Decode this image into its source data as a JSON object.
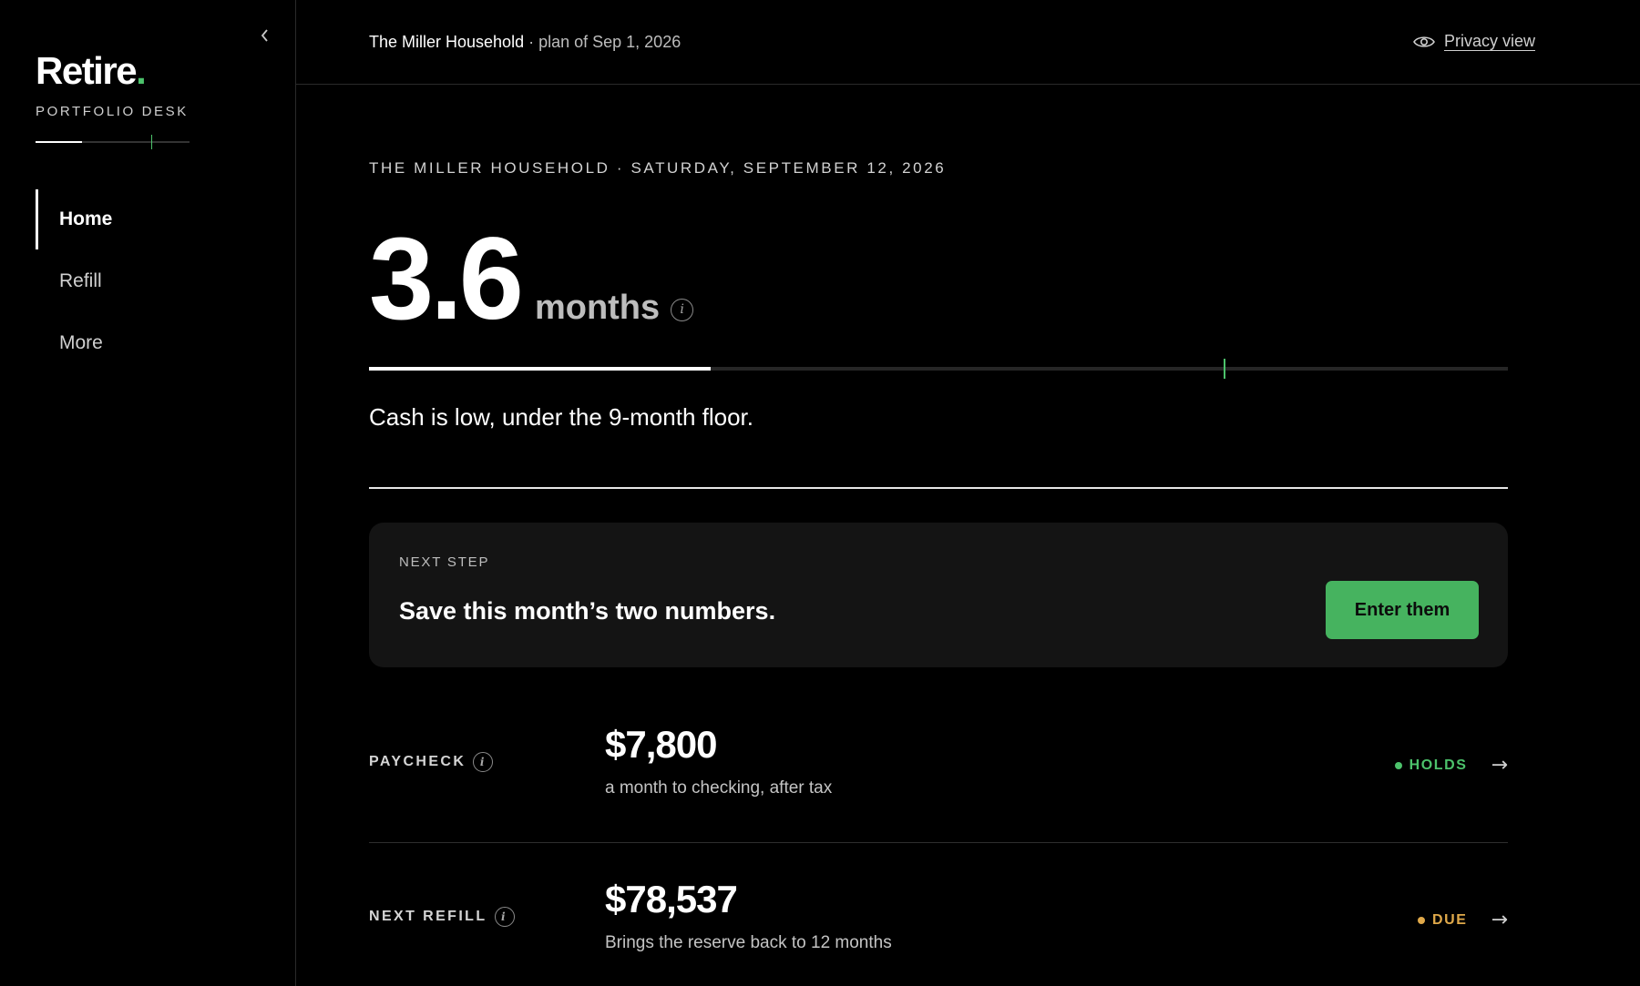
{
  "sidebar": {
    "collapse_icon": "chevron-left-icon",
    "logo_text": "Retire",
    "logo_dot": ".",
    "logo_subtitle": "PORTFOLIO DESK",
    "nav": [
      {
        "label": "Home",
        "active": true
      },
      {
        "label": "Refill",
        "active": false
      },
      {
        "label": "More",
        "active": false
      }
    ]
  },
  "header": {
    "household": "The Miller Household",
    "plan_note": "· plan of Sep 1, 2026",
    "privacy_label": "Privacy view",
    "privacy_icon": "eye-icon"
  },
  "summary": {
    "eyebrow": "THE MILLER HOUSEHOLD · SATURDAY, SEPTEMBER 12, 2026",
    "value": "3.6",
    "unit": "months",
    "info_glyph": "i",
    "gauge_fill_fraction": 0.3,
    "gauge_marker_fraction": 0.75,
    "status": "Cash is low, under the 9-month floor."
  },
  "next_step": {
    "eyebrow": "NEXT STEP",
    "title": "Save this month’s two numbers.",
    "button_label": "Enter them"
  },
  "rows": [
    {
      "label": "PAYCHECK",
      "amount": "$7,800",
      "description": "a month to checking, after tax",
      "status": "HOLDS",
      "status_color": "#4cc26b",
      "arrow": "→"
    },
    {
      "label": "NEXT REFILL",
      "amount": "$78,537",
      "description": "Brings the reserve back to 12 months",
      "status": "DUE",
      "status_color": "#e0a94a",
      "arrow": "→"
    }
  ],
  "colors": {
    "accent": "#4cc26b",
    "button": "#46b35f",
    "warning": "#e0a94a",
    "background": "#000000"
  }
}
